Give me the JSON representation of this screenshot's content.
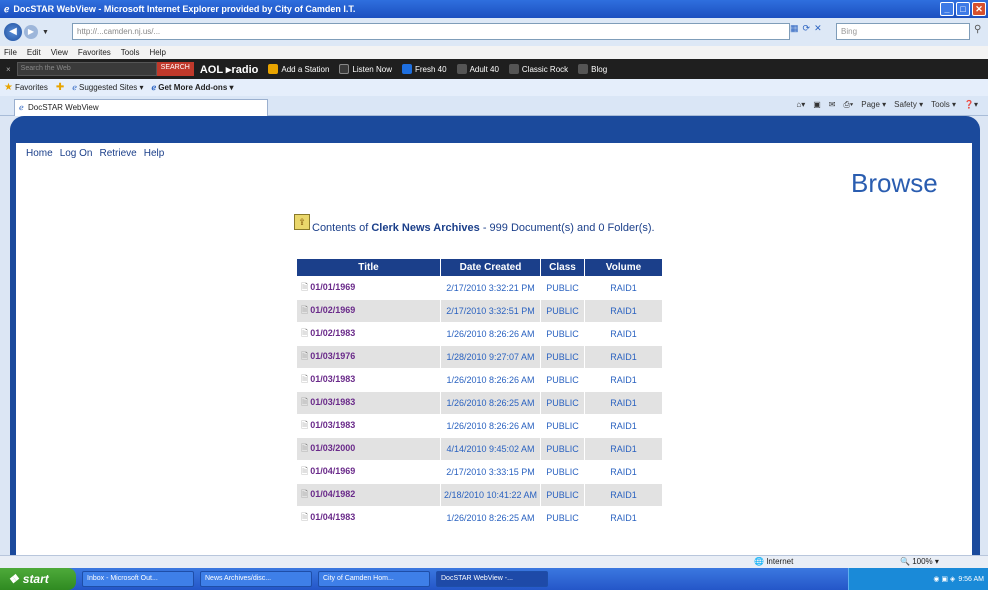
{
  "window": {
    "title": "DocSTAR WebView - Microsoft Internet Explorer provided by City of Camden I.T.",
    "buttons": [
      "_",
      "□",
      "✕"
    ]
  },
  "browser": {
    "address": "http://...camden.nj.us/...",
    "search_placeholder": "Bing",
    "menu": [
      "File",
      "Edit",
      "View",
      "Favorites",
      "Tools",
      "Help"
    ],
    "aol_toolbar": {
      "search_placeholder": "Search the Web",
      "search_button": "SEARCH",
      "brand": "AOL ▸radio",
      "items": [
        {
          "label": "Add a Station",
          "color": "#e8a400"
        },
        {
          "label": "Listen Now",
          "color": "#3a3a3a"
        },
        {
          "label": "Fresh 40",
          "color": "#1e6fe0"
        },
        {
          "label": "Adult 40",
          "color": "#555"
        },
        {
          "label": "Classic Rock",
          "color": "#555"
        },
        {
          "label": "Blog",
          "color": "#555"
        }
      ]
    },
    "favorites_bar": {
      "favorites_label": "Favorites",
      "items": [
        "Suggested Sites ▾",
        "Get More Add-ons ▾"
      ]
    },
    "tab": {
      "label": "DocSTAR WebView"
    },
    "command_bar": [
      "Page ▾",
      "Safety ▾",
      "Tools ▾"
    ]
  },
  "app": {
    "nav": [
      "Home",
      "Log On",
      "Retrieve",
      "Help"
    ],
    "page_title": "Browse",
    "contents_prefix": "Contents of",
    "folder_name": "Clerk News Archives",
    "contents_suffix": "- 999 Document(s) and 0 Folder(s).",
    "table": {
      "headers": [
        "Title",
        "Date Created",
        "Class",
        "Volume"
      ],
      "rows": [
        {
          "title": "01/01/1969",
          "date": "2/17/2010 3:32:21 PM",
          "class": "PUBLIC",
          "volume": "RAID1"
        },
        {
          "title": "01/02/1969",
          "date": "2/17/2010 3:32:51 PM",
          "class": "PUBLIC",
          "volume": "RAID1"
        },
        {
          "title": "01/02/1983",
          "date": "1/26/2010 8:26:26 AM",
          "class": "PUBLIC",
          "volume": "RAID1"
        },
        {
          "title": "01/03/1976",
          "date": "1/28/2010 9:27:07 AM",
          "class": "PUBLIC",
          "volume": "RAID1"
        },
        {
          "title": "01/03/1983",
          "date": "1/26/2010 8:26:26 AM",
          "class": "PUBLIC",
          "volume": "RAID1"
        },
        {
          "title": "01/03/1983",
          "date": "1/26/2010 8:26:25 AM",
          "class": "PUBLIC",
          "volume": "RAID1"
        },
        {
          "title": "01/03/1983",
          "date": "1/26/2010 8:26:26 AM",
          "class": "PUBLIC",
          "volume": "RAID1"
        },
        {
          "title": "01/03/2000",
          "date": "4/14/2010 9:45:02 AM",
          "class": "PUBLIC",
          "volume": "RAID1"
        },
        {
          "title": "01/04/1969",
          "date": "2/17/2010 3:33:15 PM",
          "class": "PUBLIC",
          "volume": "RAID1"
        },
        {
          "title": "01/04/1982",
          "date": "2/18/2010 10:41:22 AM",
          "class": "PUBLIC",
          "volume": "RAID1"
        },
        {
          "title": "01/04/1983",
          "date": "1/26/2010 8:26:25 AM",
          "class": "PUBLIC",
          "volume": "RAID1"
        }
      ]
    }
  },
  "statusbar": {
    "zone": "Internet",
    "zoom": "100%"
  },
  "taskbar": {
    "start": "start",
    "tasks": [
      "Inbox - Microsoft Out...",
      "News Archives/disc...",
      "City of Camden Hom...",
      "DocSTAR WebView -..."
    ],
    "clock": "9:56 AM"
  }
}
